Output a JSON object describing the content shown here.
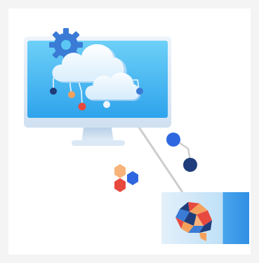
{
  "illustration": {
    "subject": "cloud-computing-and-ai-illustration",
    "colors": {
      "background": "#f4f4f4",
      "card": "#ffffff",
      "screen_top": "#5cc7f5",
      "screen_bottom": "#2fa6ec",
      "monitor_frame": "#dfeaf5",
      "stand": "#c9daec",
      "cloud": "#ffffff",
      "cloud_shade": "#c8e6fb",
      "gear": "#3a7bd5",
      "node_navy": "#1f3d7a",
      "node_red": "#e8493f",
      "node_orange": "#f5a15c",
      "node_blue": "#3a7bd5",
      "connector": "#cfcfcf",
      "hex_orange": "#f7b37a",
      "hex_blue": "#2f67e0",
      "hex_red": "#e8493f",
      "panel_left": "#dcecf8",
      "panel_right": "#3a9be8"
    },
    "icons": [
      "gear-icon",
      "cloud-icon",
      "hexagon-cluster-icon",
      "brain-icon",
      "network-node-icon"
    ]
  }
}
